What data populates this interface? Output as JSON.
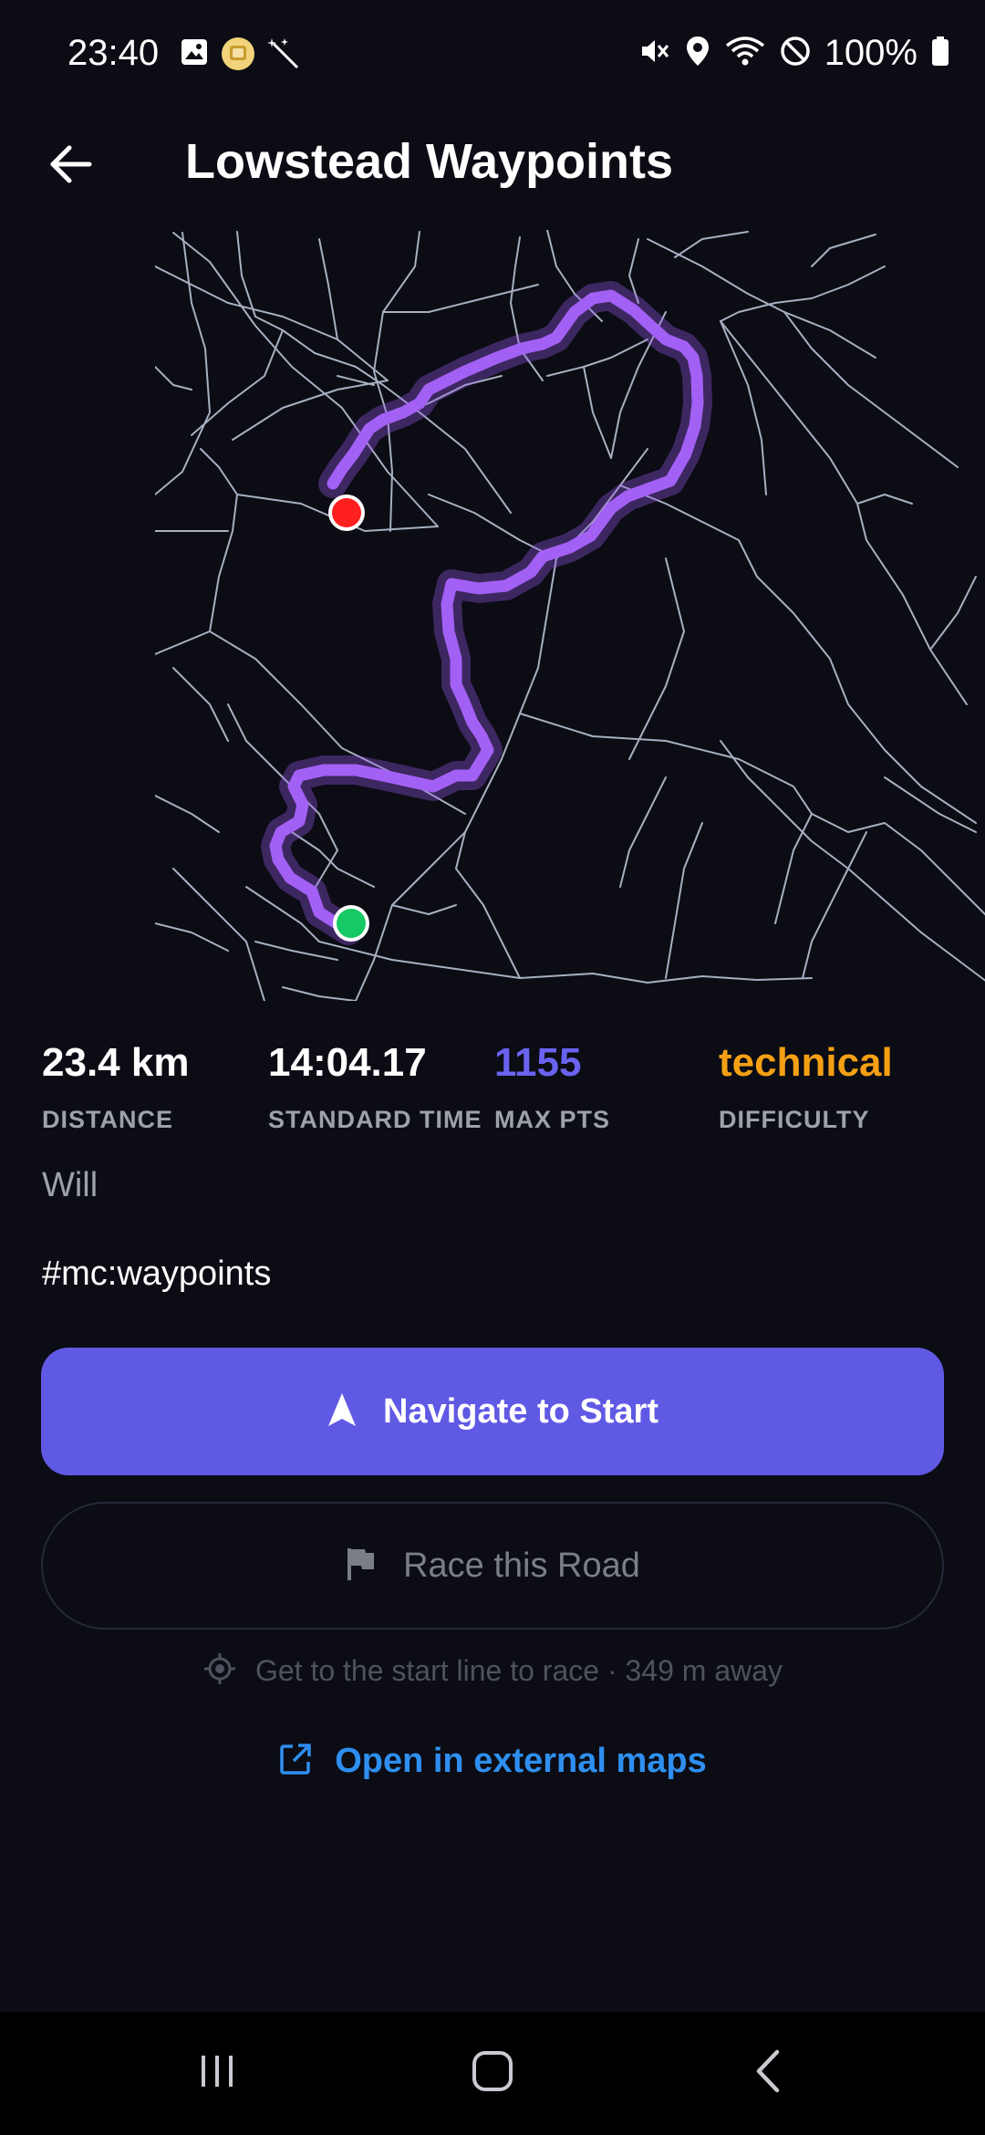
{
  "status_bar": {
    "time": "23:40",
    "battery_text": "100%",
    "left_icons": [
      "gallery-icon",
      "app-badge-icon",
      "magic-wand-icon"
    ],
    "right_icons": [
      "mute-icon",
      "location-icon",
      "wifi-icon",
      "do-not-disturb-icon",
      "battery-icon"
    ]
  },
  "header": {
    "title": "Lowstead Waypoints",
    "back_icon": "arrow-left-icon"
  },
  "map": {
    "route_color": "#9b5cf0",
    "road_color": "#b7c2d3",
    "start_marker_color": "#17c964",
    "finish_marker_color": "#ff1f1f"
  },
  "stats": {
    "distance": {
      "value": "23.4 km",
      "label": "DISTANCE"
    },
    "standard_time": {
      "value": "14:04.17",
      "label": "STANDARD TIME"
    },
    "max_pts": {
      "value": "1155",
      "label": "MAX PTS",
      "color": "#6a63f0"
    },
    "difficulty": {
      "value": "technical",
      "label": "DIFFICULTY",
      "color": "#f5a014"
    }
  },
  "author": "Will",
  "tag": "#mc:waypoints",
  "buttons": {
    "navigate": {
      "label": "Navigate to Start",
      "icon": "navigation-arrow-icon",
      "color": "#6059e4"
    },
    "race": {
      "label": "Race this Road",
      "icon": "flag-icon"
    },
    "hint": {
      "text": "Get to the start line to race · 349 m away",
      "icon": "gps-target-icon"
    },
    "external": {
      "label": "Open in external maps",
      "icon": "open-external-icon",
      "color": "#2f8ff0"
    }
  },
  "nav_bar": {
    "recents_icon": "recents-icon",
    "home_icon": "home-icon",
    "back_icon": "nav-back-icon"
  }
}
